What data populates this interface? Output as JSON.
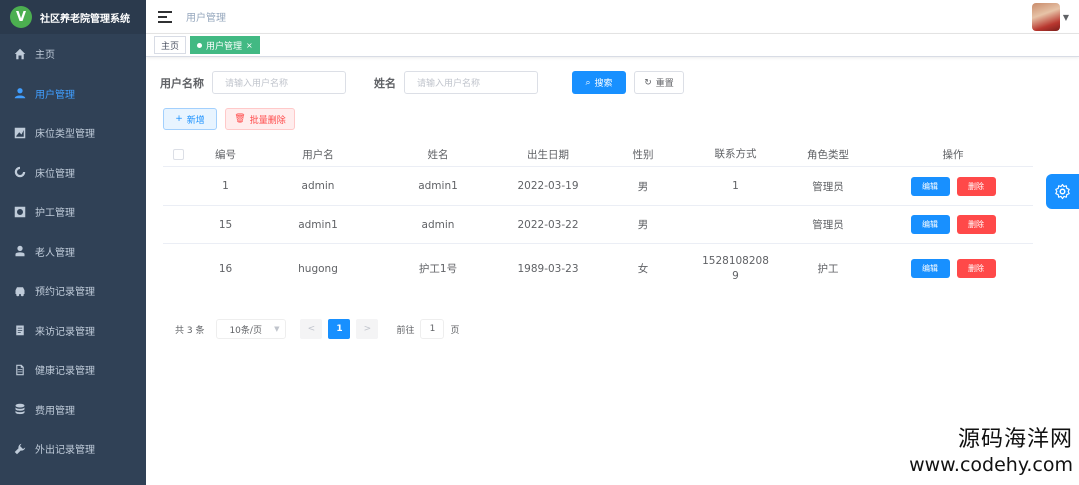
{
  "app": {
    "logo_letter": "V",
    "title": "社区养老院管理系统"
  },
  "sidebar": {
    "items": [
      {
        "label": "主页",
        "icon": "home-icon"
      },
      {
        "label": "用户管理",
        "icon": "user-icon"
      },
      {
        "label": "床位类型管理",
        "icon": "chart-icon"
      },
      {
        "label": "床位管理",
        "icon": "bed-icon"
      },
      {
        "label": "护工管理",
        "icon": "id-card-icon"
      },
      {
        "label": "老人管理",
        "icon": "person-icon"
      },
      {
        "label": "预约记录管理",
        "icon": "car-icon"
      },
      {
        "label": "来访记录管理",
        "icon": "clipboard-icon"
      },
      {
        "label": "健康记录管理",
        "icon": "document-icon"
      },
      {
        "label": "费用管理",
        "icon": "database-icon"
      },
      {
        "label": "外出记录管理",
        "icon": "wrench-icon"
      }
    ],
    "active_index": 1
  },
  "header": {
    "breadcrumb": "用户管理"
  },
  "tags": {
    "home": "主页",
    "current": "用户管理",
    "close": "×"
  },
  "search": {
    "username_label": "用户名称",
    "username_placeholder": "请输入用户名称",
    "name_label": "姓名",
    "name_placeholder": "请输入用户名称",
    "search_button": "搜索",
    "reset_button": "重置"
  },
  "actions": {
    "add": "新增",
    "batch_delete": "批量删除"
  },
  "table": {
    "columns": [
      "编号",
      "用户名",
      "姓名",
      "出生日期",
      "性别",
      "联系方式",
      "角色类型",
      "操作"
    ],
    "rows": [
      {
        "id": "1",
        "username": "admin",
        "name": "admin1",
        "birth": "2022-03-19",
        "sex": "男",
        "phone_1": "1",
        "phone_2": "",
        "role": "管理员"
      },
      {
        "id": "15",
        "username": "admin1",
        "name": "admin",
        "birth": "2022-03-22",
        "sex": "男",
        "phone_1": "",
        "phone_2": "",
        "role": "管理员"
      },
      {
        "id": "16",
        "username": "hugong",
        "name": "护工1号",
        "birth": "1989-03-23",
        "sex": "女",
        "phone_1": "1528108208",
        "phone_2": "9",
        "role": "护工"
      }
    ],
    "edit_label": "编辑",
    "delete_label": "删除"
  },
  "pagination": {
    "total": "共 3 条",
    "page_size": "10条/页",
    "prev": "<",
    "current_page": "1",
    "next": ">",
    "goto_label": "前往",
    "goto_value": "1",
    "page_suffix": "页"
  },
  "watermark": {
    "line1": "源码海洋网",
    "line2": "www.codehy.com"
  },
  "colors": {
    "sidebar_bg": "#304156",
    "primary": "#1890ff",
    "danger": "#ff4949",
    "tag_active": "#42b983"
  }
}
